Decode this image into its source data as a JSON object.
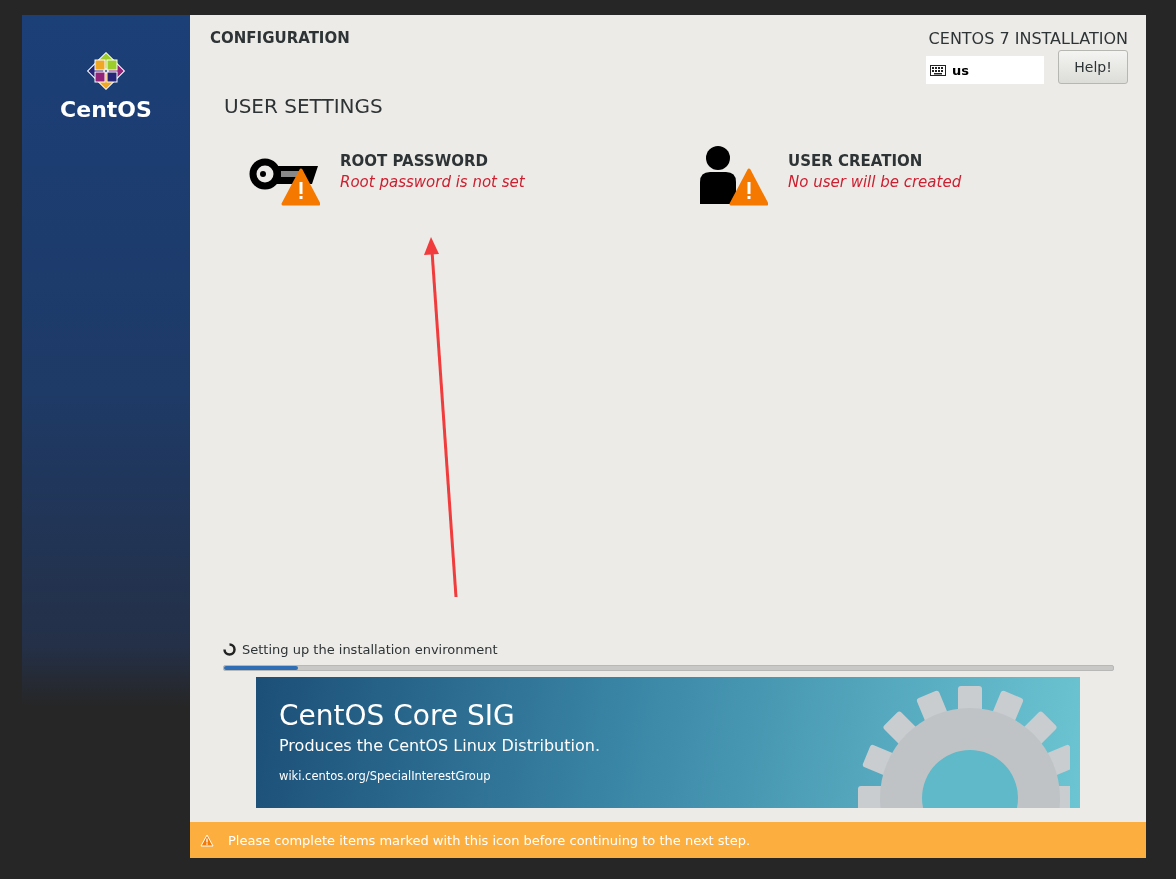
{
  "sidebar": {
    "logo_text": "CentOS"
  },
  "header": {
    "title": "CONFIGURATION",
    "product": "CENTOS 7 INSTALLATION",
    "keyboard_layout": "us",
    "help_button": "Help!"
  },
  "section": {
    "title": "USER SETTINGS",
    "spokes": [
      {
        "kind": "key",
        "title": "ROOT PASSWORD",
        "status": "Root password is not set",
        "warning": true
      },
      {
        "kind": "user",
        "title": "USER CREATION",
        "status": "No user will be created",
        "warning": true
      }
    ]
  },
  "progress": {
    "label": "Setting up the installation environment",
    "level": 0.083
  },
  "banner": {
    "title": "CentOS Core SIG",
    "subtitle": "Produces the CentOS Linux Distribution.",
    "link": "wiki.centos.org/SpecialInterestGroup"
  },
  "warning_bar": {
    "message": "Please complete items marked with this icon before continuing to the next step."
  }
}
